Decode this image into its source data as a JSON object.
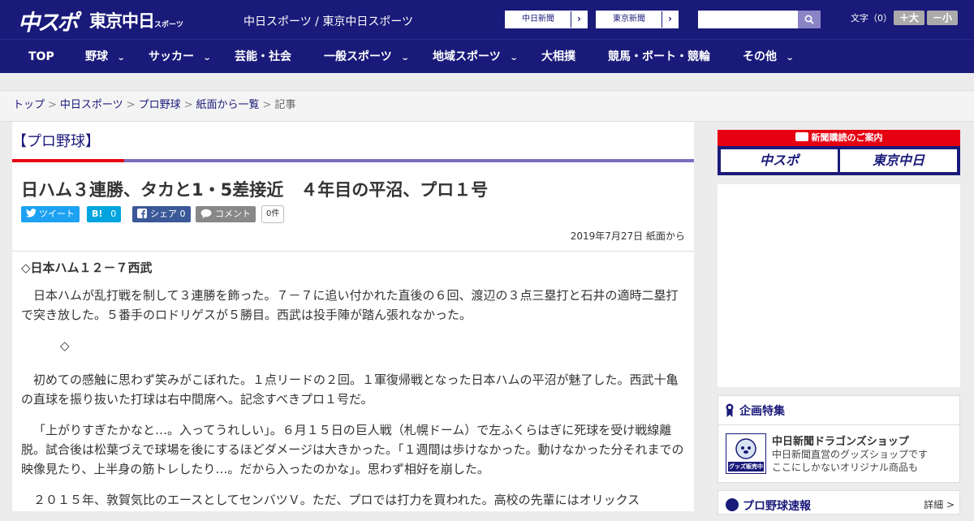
{
  "header": {
    "logo_main": "中スポ",
    "logo_tokyo": "東京中日",
    "logo_tokyo_small": "スポーツ",
    "site_title": "中日スポーツ / 東京中日スポーツ",
    "link_chunichi": "中日新聞",
    "link_tokyo": "東京新聞",
    "search_placeholder": "",
    "fontsize_label": "文字（0）",
    "fontsize_up": "＋大",
    "fontsize_down": "－小"
  },
  "nav": {
    "items": [
      {
        "label": "TOP"
      },
      {
        "label": "野球"
      },
      {
        "label": "サッカー"
      },
      {
        "label": "芸能・社会"
      },
      {
        "label": "一般スポーツ"
      },
      {
        "label": "地域スポーツ"
      },
      {
        "label": "大相撲"
      },
      {
        "label": "競馬・ボート・競輪"
      },
      {
        "label": "その他"
      }
    ]
  },
  "breadcrumb": {
    "items": [
      "トップ",
      "中日スポーツ",
      "プロ野球",
      "紙面から一覧"
    ],
    "current": "記事",
    "separator": ">"
  },
  "article": {
    "section": "【プロ野球】",
    "headline": "日ハム３連勝、タカと1・5差接近　４年目の平沼、プロ１号",
    "share": {
      "tweet": "ツイート",
      "hatena_icon": "B!",
      "hatena_count": "0",
      "facebook_label": "シェア 0",
      "comment": "コメント",
      "comment_count": "0件"
    },
    "date": "2019年7月27日 紙面から",
    "lead": "◇日本ハム１２－７西武",
    "paragraphs": [
      "日本ハムが乱打戦を制して３連勝を飾った。７－７に追い付かれた直後の６回、渡辺の３点三塁打と石井の適時二塁打で突き放した。５番手のロドリゲスが５勝目。西武は投手陣が踏ん張れなかった。",
      "◇",
      "初めての感触に思わず笑みがこぼれた。１点リードの２回。１軍復帰戦となった日本ハムの平沼が魅了した。西武十亀の直球を振り抜いた打球は右中間席へ。記念すべきプロ１号だ。",
      "「上がりすぎたかなと…。入ってうれしい」。６月１５日の巨人戦（札幌ドーム）で左ふくらはぎに死球を受け戦線離脱。試合後は松葉づえで球場を後にするほどダメージは大きかった。「１週間は歩けなかった。動けなかった分それまでの映像見たり、上半身の筋トレしたり…。だから入ったのかな」。思わず相好を崩した。",
      "２０１５年、敦賀気比のエースとしてセンバツＶ。ただ、プロでは打力を買われた。高校の先輩にはオリックス"
    ]
  },
  "sidebar": {
    "subscribe_title": "新聞購読のご案内",
    "subscribe_chusupo": "中スポ",
    "subscribe_tokyo": "東京中日",
    "feature_title": "企画特集",
    "feature_item_title": "中日新聞ドラゴンズショップ",
    "feature_item_desc1": "中日新聞直営のグッズショップです",
    "feature_item_desc2": "ここにしかないオリジナル商品も",
    "feature_thumb_label": "グッズ販売中",
    "live_title": "プロ野球速報",
    "live_more": "詳細 >"
  },
  "colors": {
    "brand_navy": "#1a1a7a",
    "accent_red": "#e50012",
    "twitter": "#1da1f2",
    "hatena": "#00a4de",
    "facebook": "#3b5998",
    "comment": "#888888"
  }
}
